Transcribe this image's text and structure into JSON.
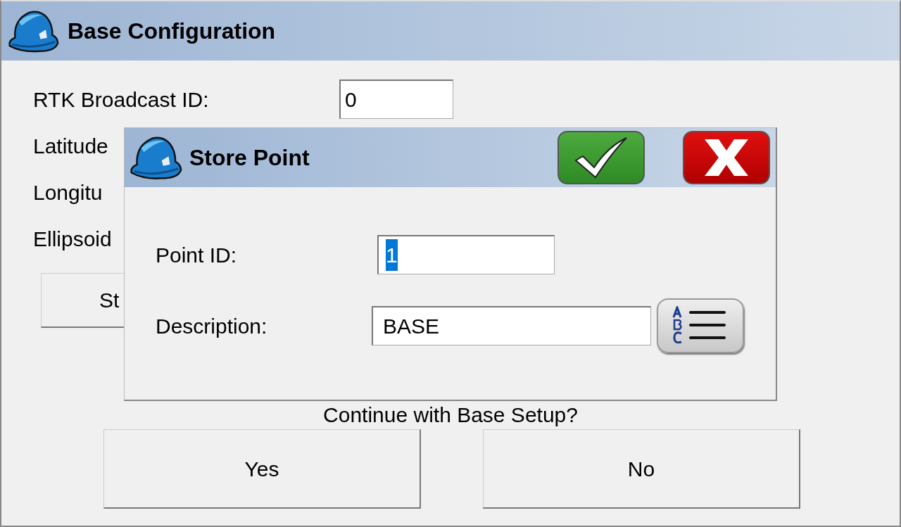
{
  "window": {
    "title": "Base Configuration"
  },
  "fields": [
    {
      "label": "RTK Broadcast ID:",
      "value": "0"
    },
    {
      "label": "Latitude"
    },
    {
      "label": "Longitu"
    },
    {
      "label": "Ellipsoid"
    }
  ],
  "store_button": {
    "label": "St"
  },
  "prompt": "Continue with Base Setup?",
  "buttons": [
    {
      "label": "Yes"
    },
    {
      "label": "No"
    }
  ],
  "dialog": {
    "title": "Store Point",
    "fields": [
      {
        "label": "Point ID:",
        "value": "1",
        "selected": true,
        "kind": "plain"
      },
      {
        "label": "Description:",
        "value": "BASE",
        "selected": false,
        "kind": "list"
      }
    ]
  }
}
